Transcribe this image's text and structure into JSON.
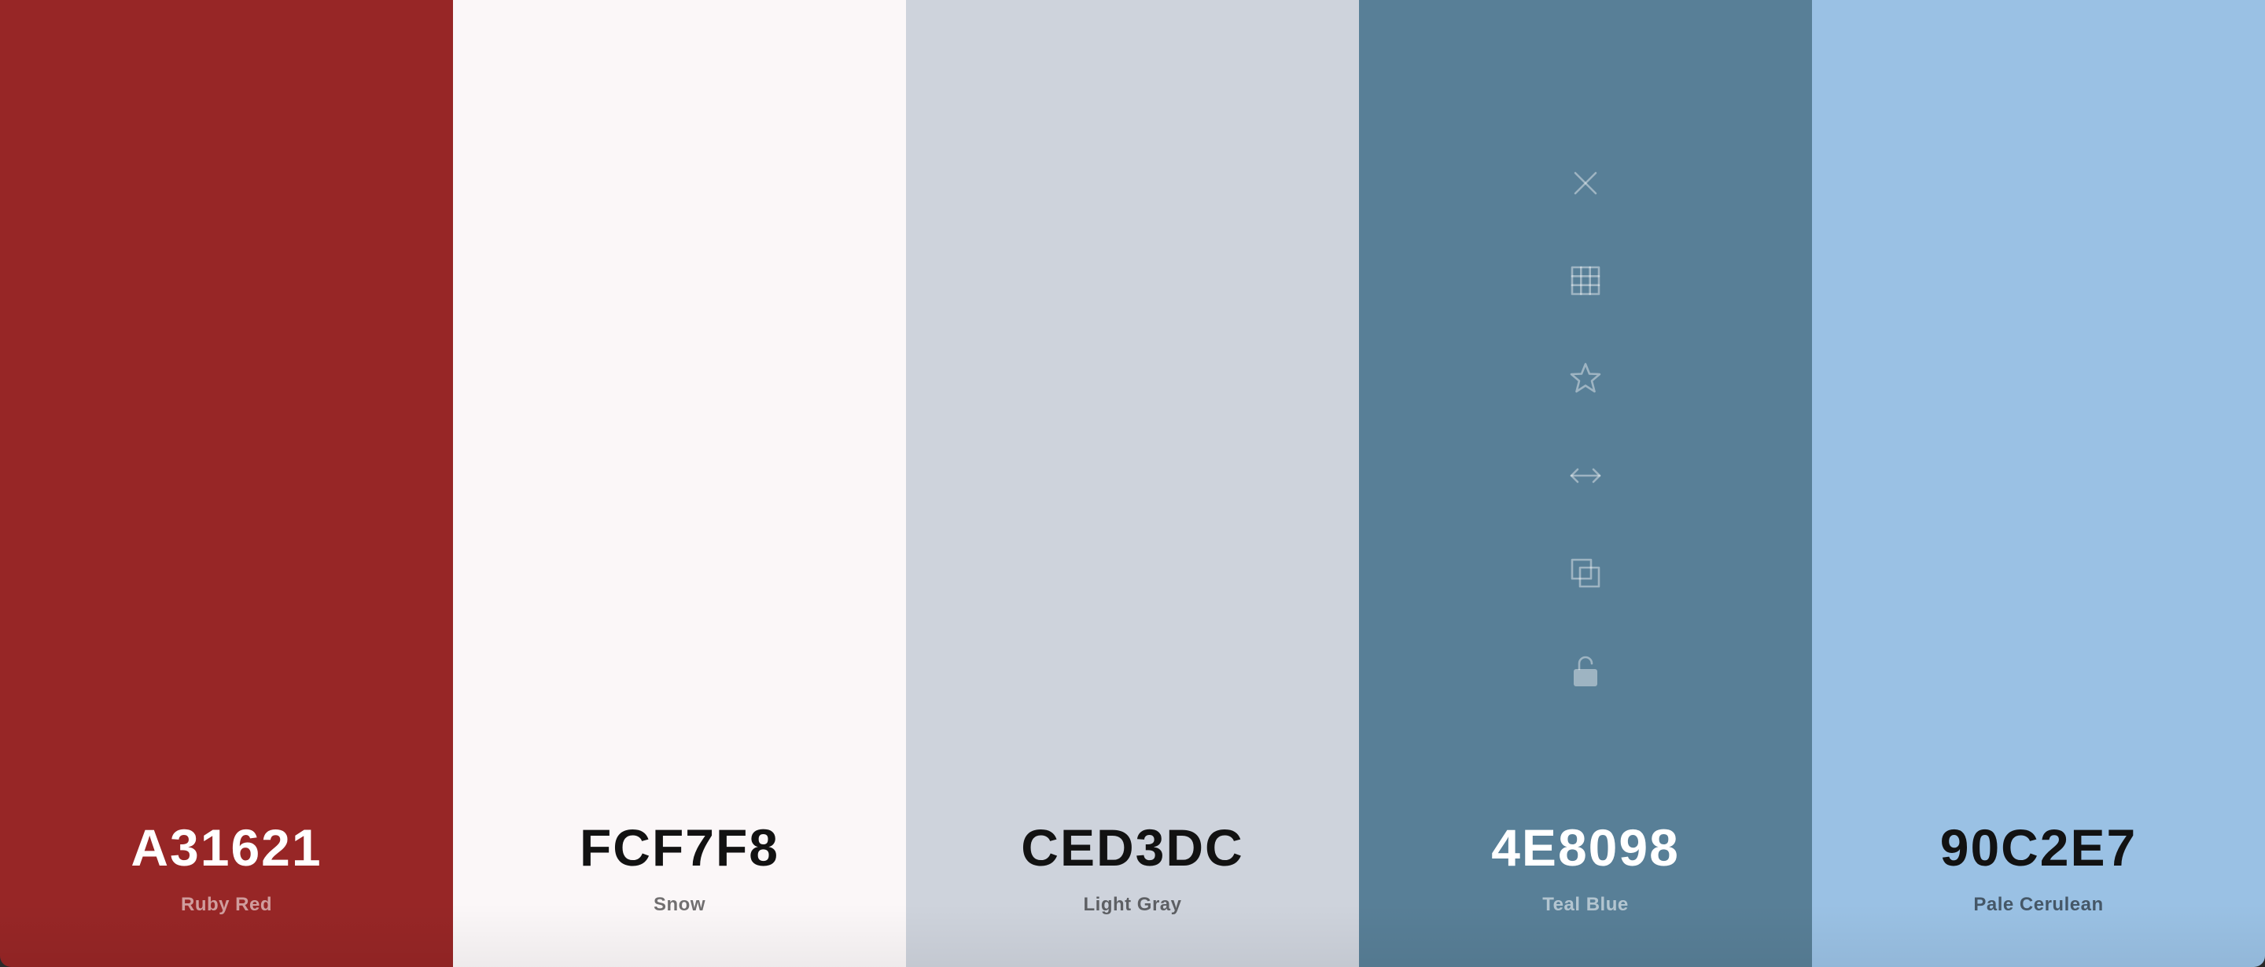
{
  "swatches": [
    {
      "hex": "A31621",
      "name": "Ruby Red",
      "color": "#972626",
      "tone": "dark"
    },
    {
      "hex": "FCF7F8",
      "name": "Snow",
      "color": "#FBF7F8",
      "tone": "light"
    },
    {
      "hex": "CED3DC",
      "name": "Light Gray",
      "color": "#CED3DC",
      "tone": "light"
    },
    {
      "hex": "4E8098",
      "name": "Teal Blue",
      "color": "#587F97",
      "tone": "dark"
    },
    {
      "hex": "90C2E7",
      "name": "Pale Cerulean",
      "color": "#9AC1E4",
      "tone": "light"
    }
  ],
  "toolbar": {
    "icons": [
      "close-icon",
      "grid-icon",
      "star-icon",
      "arrows-horizontal-icon",
      "copy-icon",
      "unlock-icon"
    ]
  }
}
